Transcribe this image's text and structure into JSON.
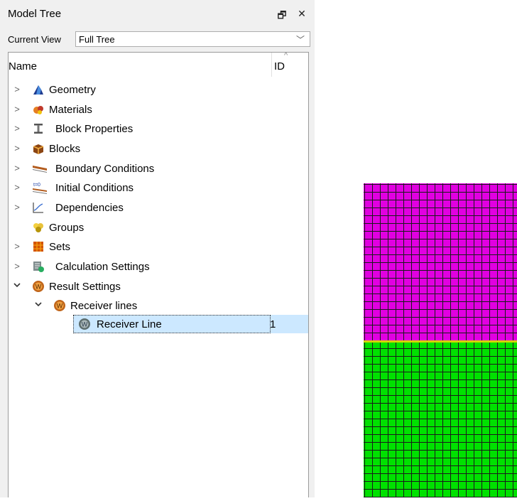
{
  "panel": {
    "title": "Model Tree",
    "float_icon": "restore-window-icon",
    "close_icon": "close-icon",
    "float_glyph": "🗗",
    "close_glyph": "✕"
  },
  "current_view": {
    "label": "Current View",
    "value": "Full Tree",
    "arrow": "﹀"
  },
  "columns": {
    "name": "Name",
    "id": "ID"
  },
  "tree": {
    "items": [
      {
        "label": "Geometry",
        "icon": "geometry-icon",
        "expander": ">"
      },
      {
        "label": "Materials",
        "icon": "materials-icon",
        "expander": ">"
      },
      {
        "label": "Block Properties",
        "icon": "block-properties-icon",
        "expander": ">"
      },
      {
        "label": "Blocks",
        "icon": "blocks-icon",
        "expander": ">"
      },
      {
        "label": "Boundary Conditions",
        "icon": "boundary-conditions-icon",
        "expander": ">"
      },
      {
        "label": "Initial Conditions",
        "icon": "initial-conditions-icon",
        "expander": ">"
      },
      {
        "label": "Dependencies",
        "icon": "dependencies-icon",
        "expander": ">"
      },
      {
        "label": "Groups",
        "icon": "groups-icon",
        "expander": ""
      },
      {
        "label": "Sets",
        "icon": "sets-icon",
        "expander": ">"
      },
      {
        "label": "Calculation Settings",
        "icon": "calculation-settings-icon",
        "expander": ">"
      },
      {
        "label": "Result Settings",
        "icon": "result-settings-icon",
        "expander": "✓"
      },
      {
        "label": "Receiver lines",
        "icon": "receiver-lines-icon",
        "expander": "✓"
      },
      {
        "label": "Receiver Line",
        "icon": "receiver-line-icon",
        "expander": "",
        "id": "1",
        "selected": true
      }
    ]
  },
  "mesh": {
    "top_color": "#e100e1",
    "bottom_color": "#00e100",
    "interface_color": "#d4d400",
    "line_color": "#1a1a1a"
  }
}
